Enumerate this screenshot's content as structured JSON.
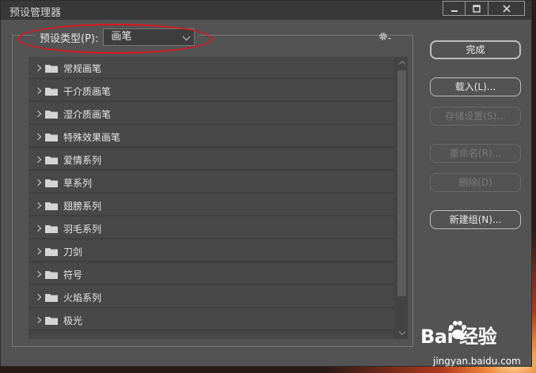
{
  "window": {
    "title": "预设管理器",
    "controls": [
      "minimize",
      "maximize",
      "close"
    ]
  },
  "preset_type": {
    "label": "预设类型(P):",
    "value": "画笔"
  },
  "menu_icon": "gear-icon",
  "folders": [
    {
      "name": "常规画笔"
    },
    {
      "name": "干介质画笔"
    },
    {
      "name": "湿介质画笔"
    },
    {
      "name": "特殊效果画笔"
    },
    {
      "name": "爱情系列"
    },
    {
      "name": "草系列"
    },
    {
      "name": "翅膀系列"
    },
    {
      "name": "羽毛系列"
    },
    {
      "name": "刀剑"
    },
    {
      "name": "符号"
    },
    {
      "name": "火焰系列"
    },
    {
      "name": "极光"
    }
  ],
  "buttons": {
    "done": "完成",
    "load": "载入(L)...",
    "save": "存储设置(S)...",
    "rename": "重命名(R)...",
    "delete": "删除(D)",
    "new_group": "新建组(N)..."
  },
  "watermark": {
    "logo_text": "Bai 经验",
    "url": "jingyan.baidu.com"
  },
  "colors": {
    "dialog_bg": "#535353",
    "titlebar_bg": "#383838",
    "list_bg": "#434343",
    "annotation_red": "#e1141b"
  }
}
